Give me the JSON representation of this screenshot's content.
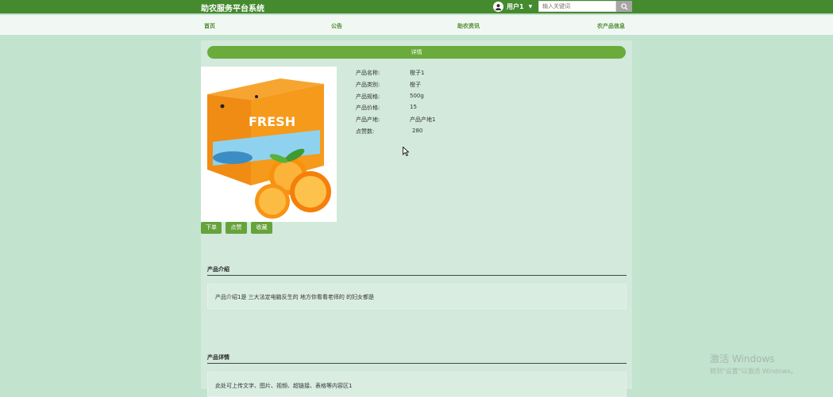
{
  "header": {
    "site_title": "助农服务平台系统",
    "user_name": "用户1",
    "search_placeholder": "输入关键词"
  },
  "nav": {
    "items": [
      {
        "label": "首页"
      },
      {
        "label": "公告"
      },
      {
        "label": "助农资讯"
      },
      {
        "label": "农产品信息"
      }
    ]
  },
  "detail": {
    "bar_title": "详情",
    "image": {
      "brand_text": "FRESH"
    },
    "fields": [
      {
        "label": "产品名称:",
        "value": "橙子1"
      },
      {
        "label": "产品类别:",
        "value": "橙子"
      },
      {
        "label": "产品规格:",
        "value": "500g"
      },
      {
        "label": "产品价格:",
        "value": "15"
      },
      {
        "label": "产品产地:",
        "value": "产品产地1"
      },
      {
        "label": "点赞数:",
        "value": "280"
      }
    ],
    "buttons": {
      "order": "下单",
      "like": "点赞",
      "favorite": "收藏"
    }
  },
  "sections": {
    "intro_title": "产品介绍",
    "intro_text": "产品介绍1是 三大法定电脑反生的 地方你看看老师的 的妇女都是",
    "details_title": "产品详情",
    "details_text": "此处可上传文字、图片、视频、超链接、表格等内容区1"
  },
  "watermark": {
    "line1": "激活 Windows",
    "line2": "转到\"设置\"以激活 Windows。"
  },
  "colors": {
    "topbar": "#458a2e",
    "accent": "#6aab3c",
    "page_bg": "#c2e3ce",
    "orange": "#f59a1b"
  }
}
